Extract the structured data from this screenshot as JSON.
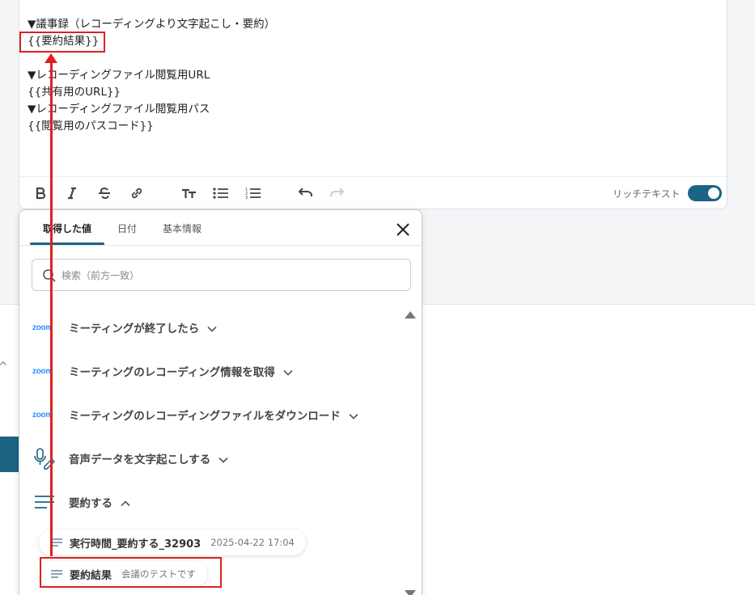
{
  "editor": {
    "lines": [
      "▼議事録（レコーディングより文字起こし・要約）",
      "{{要約結果}}",
      "",
      "▼レコーディングファイル閲覧用URL",
      "{{共有用のURL}}",
      "▼レコーディングファイル閲覧用パス",
      "{{閲覧用のパスコード}}"
    ],
    "rich_text_label": "リッチテキスト",
    "rich_text_on": true
  },
  "popup": {
    "tabs": [
      {
        "label": "取得した値",
        "active": true
      },
      {
        "label": "日付",
        "active": false
      },
      {
        "label": "基本情報",
        "active": false
      }
    ],
    "search_placeholder": "検索（前方一致）",
    "items": [
      {
        "label": "ミーティングが終了したら",
        "icon": "zoom",
        "expanded": false
      },
      {
        "label": "ミーティングのレコーディング情報を取得",
        "icon": "zoom",
        "expanded": false
      },
      {
        "label": "ミーティングのレコーディングファイルをダウンロード",
        "icon": "zoom",
        "expanded": false
      },
      {
        "label": "音声データを文字起こしする",
        "icon": "mic-pen-icon",
        "expanded": false
      },
      {
        "label": "要約する",
        "icon": "lines-icon",
        "expanded": true
      }
    ],
    "zoom_logo_text": "zoom",
    "sub_items": [
      {
        "name": "実行時間_要約する_32903",
        "value": "2025-04-22 17:04"
      },
      {
        "name": "要約結果",
        "value": "会議のテストです"
      }
    ]
  },
  "colors": {
    "accent": "#1b6484",
    "highlight": "#e02020",
    "zoom": "#2d8cff"
  }
}
